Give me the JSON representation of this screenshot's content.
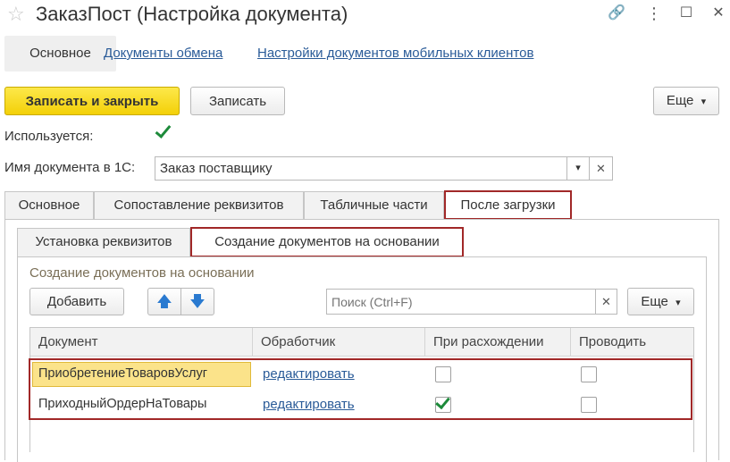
{
  "window": {
    "title": "ЗаказПост (Настройка документа)",
    "controls": {
      "link": "🔗",
      "menu": "⋮",
      "maximize": "☐",
      "close": "✕"
    },
    "star_icon": "☆"
  },
  "nav": {
    "active": "Основное",
    "links": [
      "Документы обмена",
      "Настройки документов мобильных клиентов"
    ]
  },
  "toolbar": {
    "save_close": "Записать и закрыть",
    "save": "Записать",
    "more": "Еще",
    "more_arrow": "▾"
  },
  "form": {
    "used_label": "Используется:",
    "used_checked": true,
    "doc_name_label": "Имя документа в 1С:",
    "doc_name_value": "Заказ поставщику",
    "dropdown_arrow": "▾",
    "clear": "✕"
  },
  "tabs": {
    "main": [
      "Основное",
      "Сопоставление реквизитов",
      "Табличные части",
      "После загрузки"
    ],
    "active_main_index": 3,
    "sub": [
      "Установка реквизитов",
      "Создание документов на основании"
    ],
    "active_sub_index": 1
  },
  "group": {
    "title": "Создание документов на основании",
    "add": "Добавить",
    "up_icon": "🡅",
    "down_icon": "🡇",
    "search_placeholder": "Поиск (Ctrl+F)",
    "search_clear": "✕",
    "more": "Еще",
    "more_arrow": "▾"
  },
  "table": {
    "columns": [
      "Документ",
      "Обработчик",
      "При расхождении",
      "Проводить"
    ],
    "rows": [
      {
        "document": "ПриобретениеТоваровУслуг",
        "handler": "редактировать",
        "on_mismatch": false,
        "post": false
      },
      {
        "document": "ПриходныйОрдерНаТовары",
        "handler": "редактировать",
        "on_mismatch": true,
        "post": false
      }
    ]
  },
  "colors": {
    "primary_button": "#f5d40e",
    "highlight_border": "#a12828",
    "link": "#2a5b98",
    "selected_cell": "#fbe38a",
    "check": "#1d8a3a"
  }
}
